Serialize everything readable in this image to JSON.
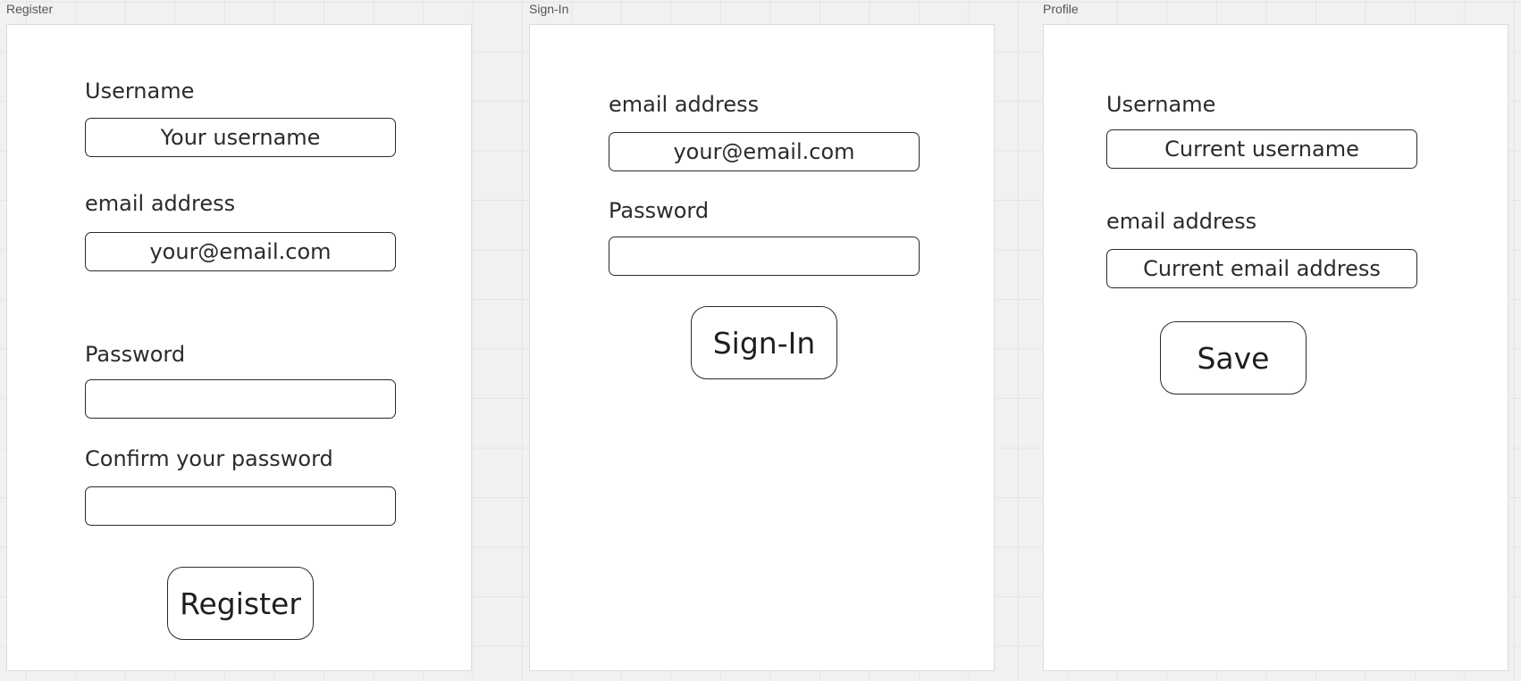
{
  "frames": {
    "register": {
      "title": "Register",
      "username_label": "Username",
      "username_placeholder": "Your username",
      "email_label": "email address",
      "email_placeholder": "your@email.com",
      "password_label": "Password",
      "password_value": "",
      "confirm_label": "Confirm your password",
      "confirm_value": "",
      "button_label": "Register"
    },
    "signin": {
      "title": "Sign-In",
      "email_label": "email address",
      "email_placeholder": "your@email.com",
      "password_label": "Password",
      "password_value": "",
      "button_label": "Sign-In"
    },
    "profile": {
      "title": "Profile",
      "username_label": "Username",
      "username_placeholder": "Current username",
      "email_label": "email address",
      "email_placeholder": "Current email address",
      "button_label": "Save"
    }
  }
}
